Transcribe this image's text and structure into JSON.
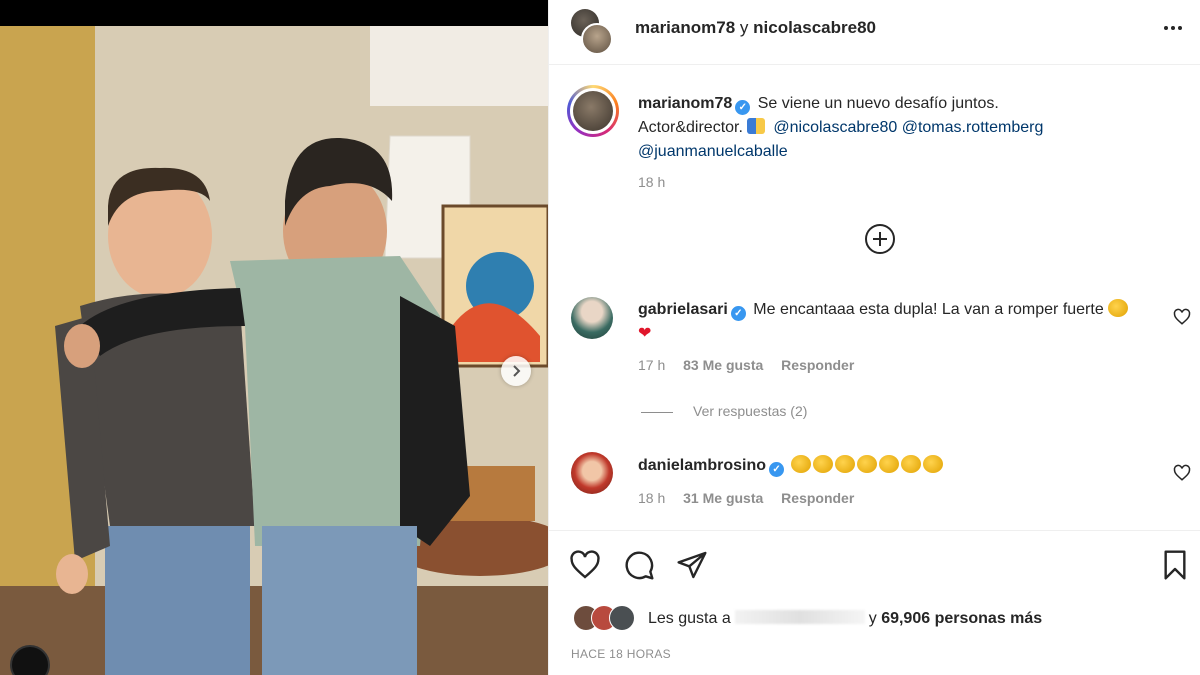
{
  "post": {
    "header": {
      "author": "marianom78",
      "connector": "y",
      "coauthor": "nicolascabre80",
      "more_icon": "more-horizontal-icon"
    },
    "caption": {
      "user": "marianom78",
      "text_1": "Se viene un nuevo desafío juntos.",
      "text_2": "Actor&director.",
      "mentions": [
        "@nicolascabre80",
        "@tomas.rottemberg",
        "@juanmanuelcaballe"
      ],
      "time": "18 h"
    },
    "comments": [
      {
        "user": "gabrielasari",
        "verified": true,
        "text": "Me encantaaa esta dupla! La van a romper fuerte",
        "time": "17 h",
        "likes": "83 Me gusta",
        "reply": "Responder",
        "view_replies": "Ver respuestas (2)"
      },
      {
        "user": "danielambrosino",
        "verified": true,
        "text": "",
        "time": "18 h",
        "likes": "31 Me gusta",
        "reply": "Responder"
      }
    ],
    "likes": {
      "prefix": "Les gusta a",
      "connector": "y",
      "count": "69,906 personas más"
    },
    "timestamp": "HACE 18 HORAS"
  },
  "colors": {
    "link": "#00376b",
    "secondary_text": "#8e8e8e",
    "verified": "#3897f0",
    "heart": "#e0162b"
  }
}
